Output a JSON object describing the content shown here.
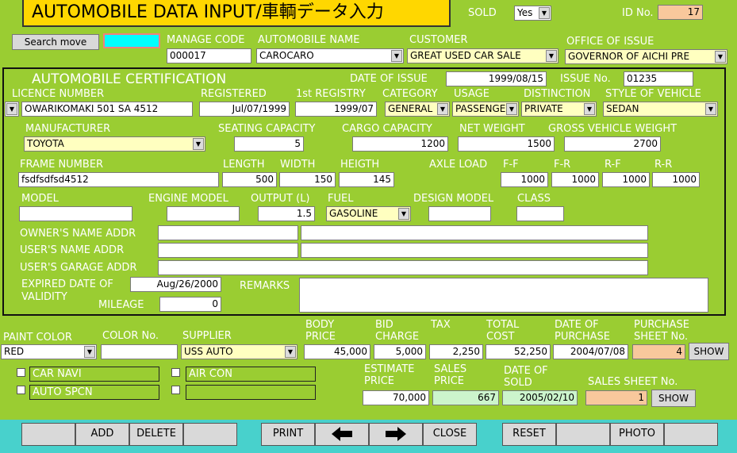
{
  "header": {
    "title": "AUTOMOBILE DATA INPUT/車輌データ入力",
    "sold_label": "SOLD",
    "sold_value": "Yes",
    "id_label": "ID No.",
    "id_value": "17"
  },
  "top": {
    "search_button": "Search move",
    "search_value": "",
    "manage_code_label": "MANAGE CODE",
    "manage_code": "000017",
    "auto_name_label": "AUTOMOBILE NAME",
    "auto_name": "CAROCARO",
    "customer_label": "CUSTOMER",
    "customer": "GREAT USED CAR SALE",
    "office_label": "OFFICE OF ISSUE",
    "office": "GOVERNOR OF AICHI PRE"
  },
  "cert": {
    "title": "AUTOMOBILE CERTIFICATION",
    "date_of_issue_label": "DATE OF ISSUE",
    "date_of_issue": "1999/08/15",
    "issue_no_label": "ISSUE No.",
    "issue_no": "01235",
    "licence_label": "LICENCE NUMBER",
    "licence": "OWARIKOMAKI 501  SA 4512",
    "registered_label": "REGISTERED",
    "registered": "Jul/07/1999",
    "first_registry_label": "1st REGISTRY",
    "first_registry": "1999/07",
    "category_label": "CATEGORY",
    "category": "GENERAL",
    "usage_label": "USAGE",
    "usage": "PASSENGER",
    "distinction_label": "DISTINCTION",
    "distinction": "PRIVATE",
    "style_label": "STYLE OF VEHICLE",
    "style": "SEDAN",
    "manufacturer_label": "MANUFACTURER",
    "manufacturer": "TOYOTA",
    "seating_label": "SEATING CAPACITY",
    "seating": "5",
    "cargo_label": "CARGO CAPACITY",
    "cargo": "1200",
    "net_weight_label": "NET WEIGHT",
    "net_weight": "1500",
    "gross_weight_label": "GROSS VEHICLE WEIGHT",
    "gross_weight": "2700",
    "frame_label": "FRAME NUMBER",
    "frame": "fsdfsdfsd4512",
    "length_label": "LENGTH",
    "length": "500",
    "width_label": "WIDTH",
    "width": "150",
    "height_label": "HEIGTH",
    "height": "145",
    "axle_label": "AXLE LOAD",
    "ff_label": "F-F",
    "ff": "1000",
    "fr_label": "F-R",
    "fr": "1000",
    "rf_label": "R-F",
    "rf": "1000",
    "rr_label": "R-R",
    "rr": "1000",
    "model_label": "MODEL",
    "model": "",
    "engine_model_label": "ENGINE MODEL",
    "engine_model": "",
    "output_label": "OUTPUT (L)",
    "output": "1.5",
    "fuel_label": "FUEL",
    "fuel": "GASOLINE",
    "design_model_label": "DESIGN MODEL",
    "design_model": "",
    "class_label": "CLASS",
    "class": "",
    "owner_label": "OWNER'S NAME ADDR",
    "user_label": "USER'S NAME ADDR",
    "garage_label": "USER'S GARAGE ADDR",
    "expired_label": "EXPIRED DATE OF",
    "validity_label": "VALIDITY",
    "expired": "Aug/26/2000",
    "mileage_label": "MILEAGE",
    "mileage": "0",
    "remarks_label": "REMARKS"
  },
  "purchase": {
    "paint_label": "PAINT COLOR",
    "paint": "RED",
    "color_no_label": "COLOR No.",
    "color_no": "",
    "supplier_label": "SUPPLIER",
    "supplier": "USS AUTO",
    "body_price_label": "BODY PRICE",
    "body_price": "45,000",
    "bid_charge_label": "BID CHARGE",
    "bid_charge": "5,000",
    "tax_label": "TAX",
    "tax": "2,250",
    "total_cost_label": "TOTAL COST",
    "total_cost": "52,250",
    "date_purchase_label": "DATE OF PURCHASE",
    "date_purchase": "2004/07/08",
    "purchase_sheet_label": "PURCHASE SHEET No.",
    "purchase_sheet": "4",
    "show_label": "SHOW"
  },
  "options": {
    "car_navi": "CAR NAVI",
    "air_con": "AIR CON",
    "auto_spcn": "AUTO SPCN",
    "blank": ""
  },
  "sales": {
    "estimate_label": "ESTIMATE PRICE",
    "estimate": "70,000",
    "sales_price_label": "SALES PRICE",
    "sales_price": "667",
    "date_sold_label": "DATE OF SOLD",
    "date_sold": "2005/02/10",
    "sales_sheet_label": "SALES SHEET No.",
    "sales_sheet": "1",
    "show_label": "SHOW"
  },
  "footer": {
    "add": "ADD",
    "delete": "DELETE",
    "print": "PRINT",
    "close": "CLOSE",
    "reset": "RESET",
    "photo": "PHOTO"
  }
}
